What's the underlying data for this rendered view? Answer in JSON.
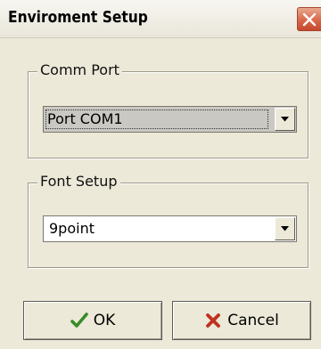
{
  "window": {
    "title": "Enviroment Setup",
    "close_icon": "close-icon"
  },
  "comm_port": {
    "legend": "Comm Port",
    "selected": "Port COM1"
  },
  "font_setup": {
    "legend": "Font Setup",
    "selected": "9point"
  },
  "buttons": {
    "ok_label": "OK",
    "ok_icon": "checkmark-icon",
    "cancel_label": "Cancel",
    "cancel_icon": "x-icon"
  },
  "colors": {
    "dialog_bg": "#ece9d8",
    "close_button": "#d9674a",
    "ok_check": "#3a8a2a",
    "cancel_x": "#c0321f"
  }
}
